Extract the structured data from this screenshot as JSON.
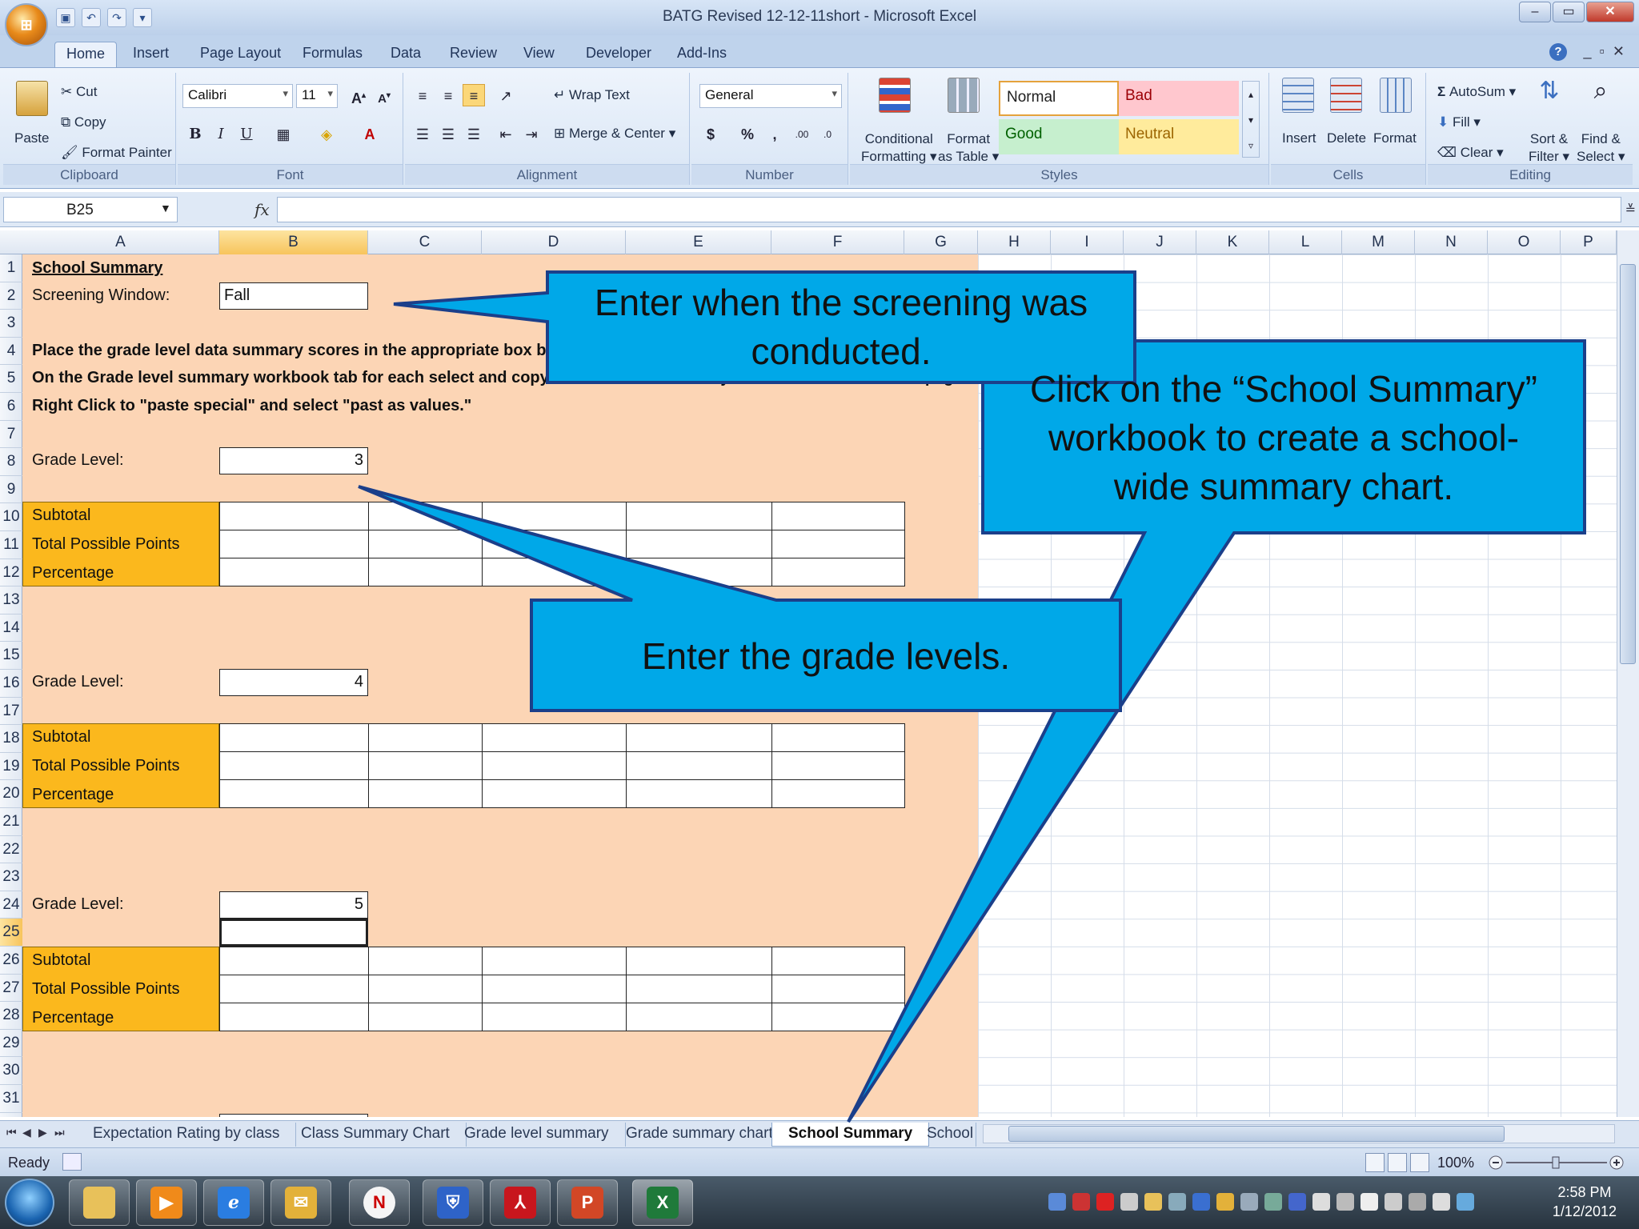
{
  "window": {
    "title": "BATG Revised 12-12-11short - Microsoft Excel",
    "minimize": "–",
    "maximize": "▭",
    "close": "✕"
  },
  "ribbon_tabs": [
    "Home",
    "Insert",
    "Page Layout",
    "Formulas",
    "Data",
    "Review",
    "View",
    "Developer",
    "Add-Ins"
  ],
  "ribbon": {
    "clipboard": {
      "label": "Clipboard",
      "paste": "Paste",
      "cut": "Cut",
      "copy": "Copy",
      "format_painter": "Format Painter"
    },
    "font": {
      "label": "Font",
      "name": "Calibri",
      "size": "11"
    },
    "alignment": {
      "label": "Alignment",
      "wrap_text": "Wrap Text",
      "merge_center": "Merge & Center"
    },
    "number": {
      "label": "Number",
      "format": "General"
    },
    "styles": {
      "label": "Styles",
      "conditional_formatting": [
        "Conditional",
        "Formatting"
      ],
      "format_as_table": [
        "Format",
        "as Table"
      ],
      "normal": "Normal",
      "bad": "Bad",
      "good": "Good",
      "neutral": "Neutral"
    },
    "cells": {
      "label": "Cells",
      "insert": "Insert",
      "delete": "Delete",
      "format": "Format"
    },
    "editing": {
      "label": "Editing",
      "autosum": "AutoSum",
      "fill": "Fill",
      "clear": "Clear",
      "sort_filter": [
        "Sort &",
        "Filter"
      ],
      "find_select": [
        "Find &",
        "Select"
      ]
    }
  },
  "formula_bar": {
    "name_box": "B25",
    "fx": "fx",
    "value": ""
  },
  "columns": [
    "A",
    "B",
    "C",
    "D",
    "E",
    "F",
    "G",
    "H",
    "I",
    "J",
    "K",
    "L",
    "M",
    "N",
    "O",
    "P"
  ],
  "rows": [
    "1",
    "2",
    "3",
    "4",
    "5",
    "6",
    "7",
    "8",
    "9",
    "10",
    "11",
    "12",
    "13",
    "14",
    "15",
    "16",
    "17",
    "18",
    "19",
    "20",
    "21",
    "22",
    "23",
    "24",
    "25",
    "26",
    "27",
    "28",
    "29",
    "30",
    "31"
  ],
  "sheet": {
    "a1": "School Summary",
    "a2": "Screening Window:",
    "b2": "Fall",
    "a4": "Place the grade level data summary scores in the appropriate box below.",
    "a5": "On the Grade level summary workbook tab for each select and copy the last class summary data at the bottom of the page.",
    "a6": "Right Click to \"paste special\" and select \"past as values.\"",
    "grade_label": "Grade Level:",
    "grade_values": [
      "3",
      "4",
      "5"
    ],
    "subtotal": "Subtotal",
    "total_points": "Total  Possible Points",
    "percentage": "Percentage"
  },
  "callouts": {
    "screening": [
      "Enter when the screening was",
      "conducted."
    ],
    "school_summary": [
      "Click on the “School Summary”",
      "workbook to create a school-",
      "wide summary chart."
    ],
    "grade_levels": "Enter the grade levels."
  },
  "sheet_tabs": [
    "Expectation Rating by class",
    "Class Summary Chart",
    "Grade level summary",
    "Grade summary chart",
    "School Summary",
    "School"
  ],
  "status": {
    "ready": "Ready",
    "zoom": "100%"
  },
  "clock": {
    "time": "2:58 PM",
    "date": "1/12/2012"
  },
  "colors": {
    "accent": "#00a8e8",
    "peach": "#fcd5b5",
    "orange": "#fbb81d"
  }
}
